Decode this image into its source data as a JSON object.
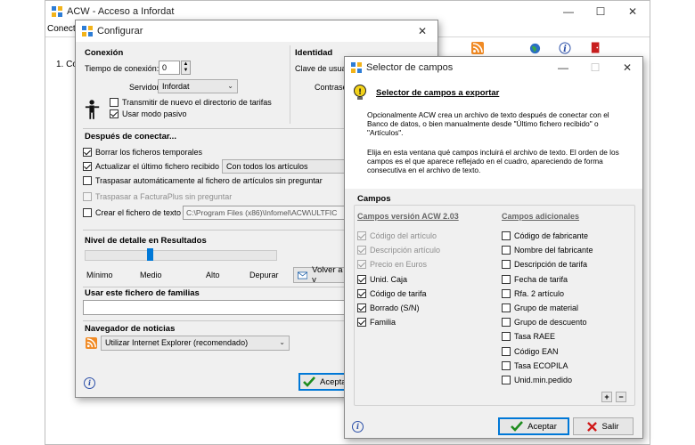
{
  "main_window": {
    "title": "ACW - Acceso a Infordat",
    "tab_label": "Conect",
    "row_label": "1. Co",
    "min": "—",
    "max": "☐",
    "close": "✕"
  },
  "config": {
    "title": "Configurar",
    "close": "✕",
    "conexion": {
      "title": "Conexión",
      "timeout_label": "Tiempo de conexión:",
      "timeout_value": "0",
      "server_label": "Servidor:",
      "server_value": "Infordat",
      "transmit_dir": "Transmitir de nuevo el directorio de tarifas",
      "passive_mode": "Usar modo pasivo"
    },
    "identidad": {
      "title": "Identidad",
      "key_label": "Clave de usua",
      "password_label": "Contrase"
    },
    "after": {
      "title": "Después de conectar...",
      "delete_temp": "Borrar los ficheros temporales",
      "update_last": "Actualizar el último fichero recibido",
      "update_select": "Con todos los artículos",
      "transfer_auto": "Traspasar automáticamente al fichero de artículos sin preguntar",
      "transfer_facturaplus": "Traspasar a FacturaPlus sin preguntar",
      "create_text": "Crear el fichero de texto",
      "text_path": "C:\\Program Files (x86)\\Infomel\\ACW\\ULTFIC"
    },
    "detail": {
      "title": "Nivel de detalle en Resultados",
      "levels": [
        "Mínimo",
        "Medio",
        "Alto",
        "Depurar"
      ],
      "level_value": 0.33,
      "volver_button": "Volver a v"
    },
    "families": {
      "title": "Usar este fichero de familias",
      "value": ""
    },
    "news": {
      "title": "Navegador de noticias",
      "browser": "Utilizar Internet Explorer (recomendado)"
    },
    "accept": "Acepta"
  },
  "selector": {
    "title": "Selector de campos",
    "min": "—",
    "max": "☐",
    "close": "✕",
    "header": "Selector de campos a exportar",
    "desc1": "Opcionalmente ACW crea un archivo de texto después de conectar con el Banco de datos, o bien manualmente desde \"Último fichero recibido\" o \"Artículos\".",
    "desc2": "Elija en esta ventana qué campos incluirá el archivo de texto. El orden de los campos es el que aparece reflejado en el cuadro, apareciendo de forma consecutiva en el archivo de texto.",
    "campos_title": "Campos",
    "col1_title": "Campos versión ACW 2.03",
    "col2_title": "Campos adicionales",
    "col1": [
      {
        "label": "Código del artículo",
        "checked": true,
        "disabled": true
      },
      {
        "label": "Descripción artículo",
        "checked": true,
        "disabled": true
      },
      {
        "label": "Precio en Euros",
        "checked": true,
        "disabled": true
      },
      {
        "label": "Unid. Caja",
        "checked": true,
        "disabled": false
      },
      {
        "label": "Código de tarifa",
        "checked": true,
        "disabled": false
      },
      {
        "label": "Borrado (S/N)",
        "checked": true,
        "disabled": false
      },
      {
        "label": "Familia",
        "checked": true,
        "disabled": false
      }
    ],
    "col2": [
      {
        "label": "Código de fabricante",
        "checked": false
      },
      {
        "label": "Nombre del fabricante",
        "checked": false
      },
      {
        "label": "Descripción de tarifa",
        "checked": false
      },
      {
        "label": "Fecha de tarifa",
        "checked": false
      },
      {
        "label": "Rfa. 2 artículo",
        "checked": false
      },
      {
        "label": "Grupo de material",
        "checked": false
      },
      {
        "label": "Grupo de descuento",
        "checked": false
      },
      {
        "label": "Tasa RAEE",
        "checked": false
      },
      {
        "label": "Código EAN",
        "checked": false
      },
      {
        "label": "Tasa ECOPILA",
        "checked": false
      },
      {
        "label": "Unid.min.pedido",
        "checked": false
      }
    ],
    "plus": "+",
    "minus": "−",
    "accept": "Aceptar",
    "exit": "Salir"
  },
  "colors": {
    "accept_check": "#1e8c1e",
    "exit_x": "#d01818",
    "info_blue": "#2b4fa8",
    "rss_orange": "#f08a24"
  }
}
